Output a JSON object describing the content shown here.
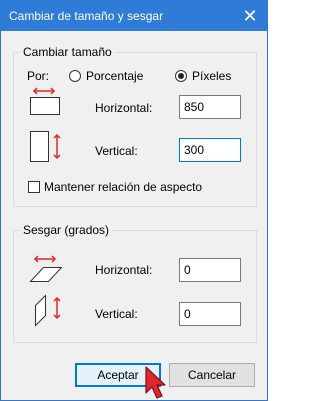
{
  "window": {
    "title": "Cambiar de tamaño y sesgar",
    "close_glyph": "✕"
  },
  "resize": {
    "legend": "Cambiar tamaño",
    "by_label": "Por:",
    "option_percent": "Porcentaje",
    "option_pixels": "Píxeles",
    "selected": "pixels",
    "horizontal_label": "Horizontal:",
    "horizontal_value": "850",
    "vertical_label": "Vertical:",
    "vertical_value": "300",
    "aspect_label": "Mantener relación de aspecto",
    "aspect_checked": false
  },
  "skew": {
    "legend": "Sesgar (grados)",
    "horizontal_label": "Horizontal:",
    "horizontal_value": "0",
    "vertical_label": "Vertical:",
    "vertical_value": "0"
  },
  "buttons": {
    "ok": "Aceptar",
    "cancel": "Cancelar"
  },
  "colors": {
    "titlebar": "#2f7bd8",
    "arrow_red": "#e3262b",
    "focus_blue": "#0078d7"
  },
  "icons": {
    "resize_horizontal": "resize-horizontal-icon",
    "resize_vertical": "resize-vertical-icon",
    "skew_horizontal": "skew-horizontal-icon",
    "skew_vertical": "skew-vertical-icon",
    "cursor": "mouse-pointer-icon"
  }
}
